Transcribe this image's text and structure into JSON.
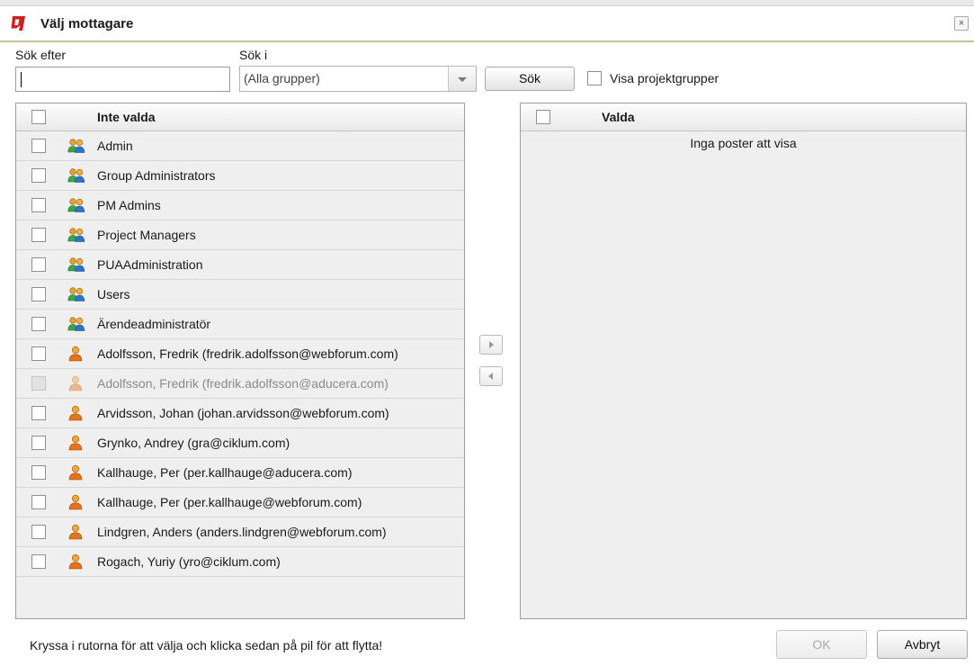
{
  "dialog": {
    "title": "Välj mottagare",
    "close_glyph": "×",
    "accent_color": "#cc1f1f"
  },
  "search": {
    "search_for_label": "Sök efter",
    "search_for_value": "",
    "search_in_label": "Sök i",
    "search_in_value": "(Alla grupper)",
    "search_button": "Sök",
    "show_project_groups_label": "Visa projektgrupper"
  },
  "left_panel": {
    "header": "Inte valda",
    "items": [
      {
        "label": "Admin",
        "type": "group",
        "icon": "group-icon"
      },
      {
        "label": "Group Administrators",
        "type": "group",
        "icon": "group-icon"
      },
      {
        "label": "PM Admins",
        "type": "group",
        "icon": "group-icon"
      },
      {
        "label": "Project Managers",
        "type": "group",
        "icon": "group-icon"
      },
      {
        "label": "PUAAdministration",
        "type": "group",
        "icon": "group-icon"
      },
      {
        "label": "Users",
        "type": "group",
        "icon": "group-icon"
      },
      {
        "label": "Ärendeadministratör",
        "type": "group",
        "icon": "group-icon"
      },
      {
        "label": "Adolfsson, Fredrik (fredrik.adolfsson@webforum.com)",
        "type": "user",
        "icon": "user-icon"
      },
      {
        "label": "Adolfsson, Fredrik (fredrik.adolfsson@aducera.com)",
        "type": "user",
        "icon": "user-icon",
        "disabled": true
      },
      {
        "label": "Arvidsson, Johan (johan.arvidsson@webforum.com)",
        "type": "user",
        "icon": "user-icon"
      },
      {
        "label": "Grynko, Andrey (gra@ciklum.com)",
        "type": "user",
        "icon": "user-icon"
      },
      {
        "label": "Kallhauge, Per (per.kallhauge@aducera.com)",
        "type": "user",
        "icon": "user-icon"
      },
      {
        "label": "Kallhauge, Per (per.kallhauge@webforum.com)",
        "type": "user",
        "icon": "user-icon"
      },
      {
        "label": "Lindgren, Anders (anders.lindgren@webforum.com)",
        "type": "user",
        "icon": "user-icon"
      },
      {
        "label": "Rogach, Yuriy (yro@ciklum.com)",
        "type": "user",
        "icon": "user-icon"
      }
    ]
  },
  "right_panel": {
    "header": "Valda",
    "empty_message": "Inga poster att visa"
  },
  "footer": {
    "hint": "Kryssa i rutorna för att välja och klicka sedan på pil för att flytta!",
    "ok_button": "OK",
    "cancel_button": "Avbryt"
  }
}
